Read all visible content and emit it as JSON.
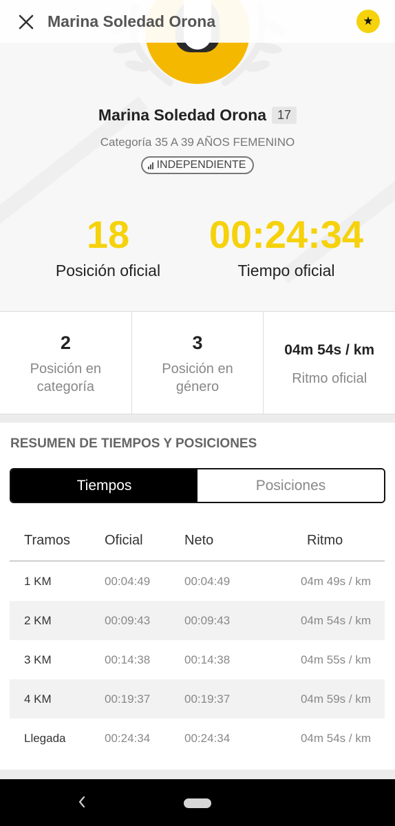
{
  "header": {
    "title": "Marina Soledad Orona",
    "close_icon": "close-icon",
    "favorite_icon": "star-icon",
    "accent_color": "#f5d20b"
  },
  "runner": {
    "name": "Marina Soledad Orona",
    "bib_badge": "17",
    "category": "Categoría 35 A 39 AÑOS FEMENINO",
    "team": "INDEPENDIENTE",
    "avatar_icon": "female-avatar-icon"
  },
  "official": {
    "position_value": "18",
    "position_label": "Posición oficial",
    "time_value": "00:24:34",
    "time_label": "Tiempo oficial"
  },
  "substats": [
    {
      "value": "2",
      "label": "Posición en categoría"
    },
    {
      "value": "3",
      "label": "Posición en género"
    },
    {
      "value": "04m 54s / km",
      "label": "Ritmo oficial"
    }
  ],
  "summary": {
    "title": "RESUMEN DE TIEMPOS Y POSICIONES",
    "tabs": [
      {
        "label": "Tiempos",
        "active": true
      },
      {
        "label": "Posiciones",
        "active": false
      }
    ],
    "columns": [
      "Tramos",
      "Oficial",
      "Neto",
      "Ritmo"
    ],
    "rows": [
      {
        "tramo": "1 KM",
        "oficial": "00:04:49",
        "neto": "00:04:49",
        "ritmo": "04m 49s / km"
      },
      {
        "tramo": "2 KM",
        "oficial": "00:09:43",
        "neto": "00:09:43",
        "ritmo": "04m 54s / km"
      },
      {
        "tramo": "3 KM",
        "oficial": "00:14:38",
        "neto": "00:14:38",
        "ritmo": "04m 55s / km"
      },
      {
        "tramo": "4 KM",
        "oficial": "00:19:37",
        "neto": "00:19:37",
        "ritmo": "04m 59s / km"
      },
      {
        "tramo": "Llegada",
        "oficial": "00:24:34",
        "neto": "00:24:34",
        "ritmo": "04m 54s / km"
      }
    ]
  },
  "system_nav": {
    "back_icon": "back-icon",
    "home_icon": "home-pill-icon"
  }
}
